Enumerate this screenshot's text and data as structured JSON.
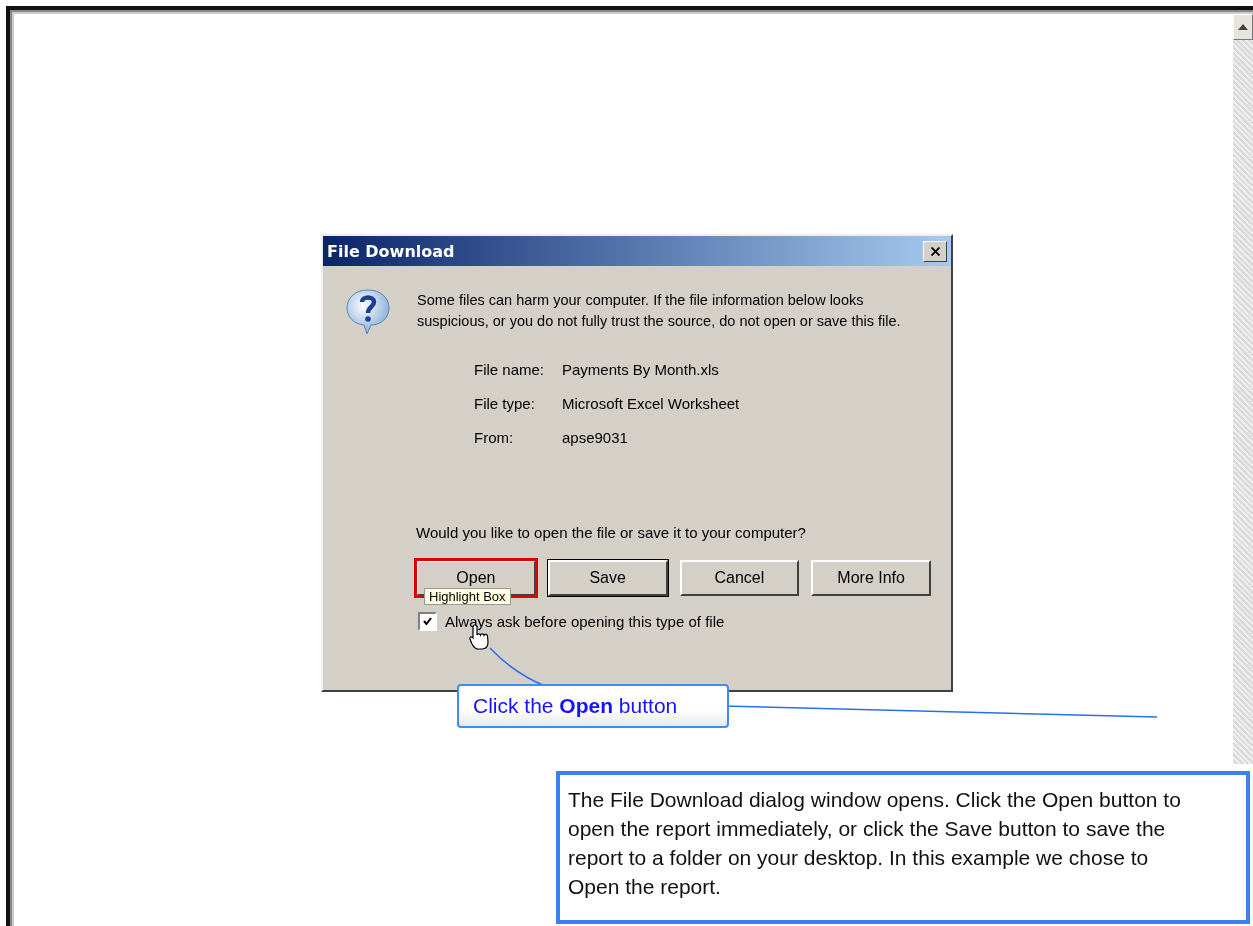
{
  "dialog": {
    "title": "File Download",
    "message": "Some files can harm your computer. If the file information below looks suspicious, or you do not fully trust the source, do not open or save this file.",
    "fields": [
      {
        "label": "File name:",
        "value": "Payments By Month.xls"
      },
      {
        "label": "File type:",
        "value": "Microsoft Excel Worksheet"
      },
      {
        "label": "From:",
        "value": "apse9031"
      }
    ],
    "question": "Would you like to open the file or save it to your computer?",
    "buttons": [
      {
        "label": "Open",
        "highlighted": true,
        "default": false
      },
      {
        "label": "Save",
        "highlighted": false,
        "default": true
      },
      {
        "label": "Cancel",
        "highlighted": false,
        "default": false
      },
      {
        "label": "More Info",
        "highlighted": false,
        "default": false
      }
    ],
    "checkbox": {
      "label": "Always ask before opening this type of file",
      "checked": true
    }
  },
  "highlight_label": "Highlight Box",
  "callout": "Click the **Open** button",
  "note": "The File Download dialog window opens.  Click the Open button to open the report immediately, or click the Save button to save the report to a folder on your desktop. In this example we chose to Open the report."
}
